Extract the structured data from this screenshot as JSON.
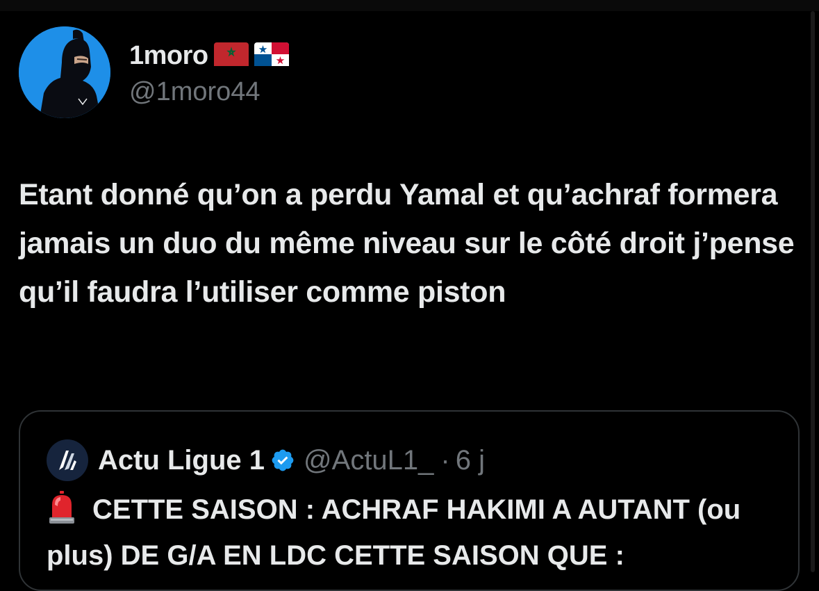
{
  "post": {
    "author": {
      "display_name": "1moro",
      "handle": "@1moro44",
      "flags": [
        "morocco-flag-icon",
        "panama-flag-icon"
      ]
    },
    "text": "Etant donné qu’on a perdu Yamal et qu’achraf formera jamais un duo du même niveau sur le côté droit j’pense qu’il faudra l’utiliser comme piston"
  },
  "quote": {
    "author": {
      "display_name": "Actu Ligue 1",
      "handle": "@ActuL1_",
      "verified": true
    },
    "separator": "·",
    "time": "6 j",
    "leading_icon": "siren-icon",
    "text": "CETTE SAISON : ACHRAF HAKIMI A AUTANT (ou plus) DE G/A EN LDC CETTE SAISON QUE :"
  },
  "colors": {
    "background": "#000000",
    "primary_text": "#e7e9ea",
    "secondary_text": "#71767b",
    "border": "#2f3336",
    "verified_blue": "#1d9bf0",
    "avatar_bg": "#1e8fe8"
  }
}
